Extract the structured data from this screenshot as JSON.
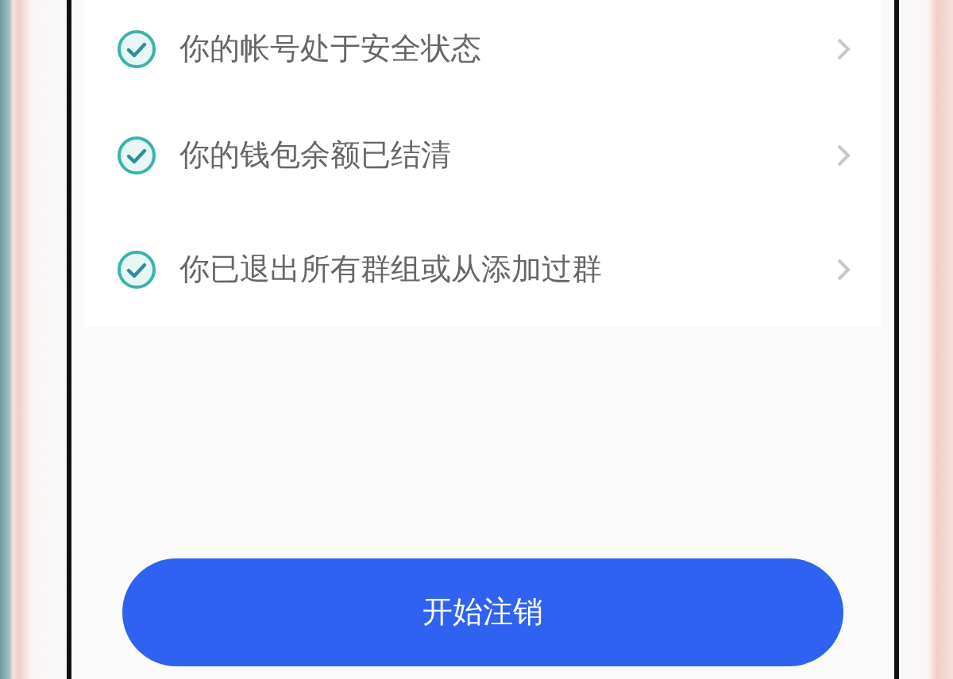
{
  "conditions": [
    {
      "label": "你的帐号处于安全状态",
      "checked": true
    },
    {
      "label": "你的钱包余额已结清",
      "checked": true
    },
    {
      "label": "你已退出所有群组或从添加过群",
      "checked": true
    }
  ],
  "button": {
    "label": "开始注销"
  }
}
